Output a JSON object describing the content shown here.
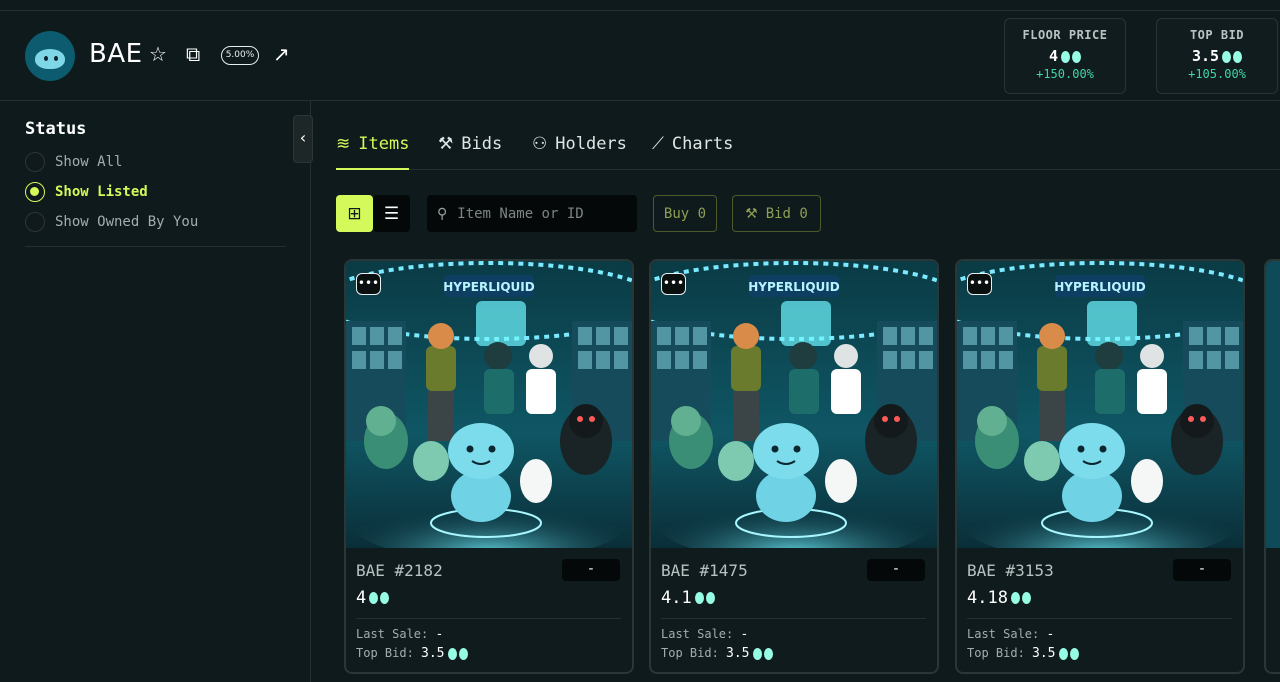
{
  "collection": {
    "name": "BAE",
    "royalty": "5.00%"
  },
  "stats": {
    "floor": {
      "label": "FLOOR PRICE",
      "value": "4",
      "change": "+150.00%"
    },
    "top_bid": {
      "label": "TOP BID",
      "value": "3.5",
      "change": "+105.00%"
    }
  },
  "sidebar": {
    "status_title": "Status",
    "options": [
      {
        "label": "Show All",
        "selected": false
      },
      {
        "label": "Show Listed",
        "selected": true
      },
      {
        "label": "Show Owned By You",
        "selected": false
      }
    ]
  },
  "tabs": [
    {
      "label": "Items",
      "active": true,
      "icon": "layers-icon"
    },
    {
      "label": "Bids",
      "active": false,
      "icon": "gavel-icon"
    },
    {
      "label": "Holders",
      "active": false,
      "icon": "users-icon"
    },
    {
      "label": "Charts",
      "active": false,
      "icon": "line-chart-icon"
    }
  ],
  "toolbar": {
    "search_placeholder": "Item Name or ID",
    "buy_label": "Buy 0",
    "bid_label": "Bid 0"
  },
  "cards": [
    {
      "name": "BAE #2182",
      "price": "4",
      "pill": "-",
      "last_sale_label": "Last Sale:",
      "last_sale": "-",
      "top_bid_label": "Top Bid:",
      "top_bid": "3.5"
    },
    {
      "name": "BAE #1475",
      "price": "4.1",
      "pill": "-",
      "last_sale_label": "Last Sale:",
      "last_sale": "-",
      "top_bid_label": "Top Bid:",
      "top_bid": "3.5"
    },
    {
      "name": "BAE #3153",
      "price": "4.18",
      "pill": "-",
      "last_sale_label": "Last Sale:",
      "last_sale": "-",
      "top_bid_label": "Top Bid:",
      "top_bid": "3.5"
    }
  ],
  "artwork": {
    "banner_text": "HYPERLIQUID"
  },
  "colors": {
    "accent": "#d4f95a",
    "positive": "#3fd6a8",
    "hype": "#97fce4"
  }
}
